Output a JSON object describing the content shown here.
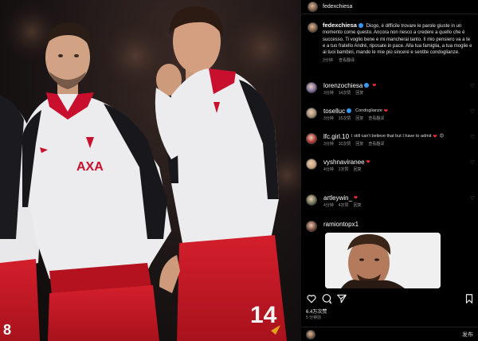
{
  "post": {
    "username": "fedexchiesa",
    "caption_user": "fedexchiesa",
    "caption_text": "Diogo, è difficile trovare le parole giuste in un momento come questo. Ancora non riesco a credere a quello che è successo. Ti voglio bene e mi mancherai tanto. Il mio pensiero va a te e a tuo fratello André, riposate in pace. Alla tua famiglia, a tua moglie e ai tuoi bambini, mando le mie più sincere e sentite condoglianze.",
    "caption_time": "3分钟",
    "caption_translate": "查看翻译",
    "likes": "6.4万次赞",
    "time": "5 分钟前",
    "compose_placeholder": "",
    "post_label": "发布"
  },
  "photo": {
    "jersey_left_text": "AXA",
    "jersey_right_number": "14",
    "left_number": "8"
  },
  "comments": [
    {
      "user": "lorenzochiesa",
      "text": "",
      "verified": true,
      "heart": true,
      "emoji": "",
      "time": "3分钟",
      "likes": "14次赞",
      "reply": "回复",
      "translate": "",
      "avatar_color": "#7a6a9a"
    },
    {
      "user": "toselluc",
      "text": "Condoglianze",
      "verified": true,
      "heart": true,
      "emoji": "",
      "time": "3分钟",
      "likes": "15次赞",
      "reply": "回复",
      "translate": "查看翻译",
      "avatar_color": "#a08a70"
    },
    {
      "user": "lfc.girl.10",
      "text": "I still can't believe that but I have to admit",
      "verified": false,
      "heart": true,
      "emoji": "😊",
      "time": "3分钟",
      "likes": "10次赞",
      "reply": "回复",
      "translate": "查看翻译",
      "avatar_color": "#b03030"
    },
    {
      "user": "vyshnaviranee",
      "text": "",
      "verified": false,
      "heart": true,
      "emoji": "",
      "time": "4分钟",
      "likes": "2次赞",
      "reply": "回复",
      "translate": "",
      "avatar_color": "#c9a07a"
    },
    {
      "user": "artleywin_",
      "text": "",
      "verified": false,
      "heart": true,
      "emoji": "",
      "time": "4分钟",
      "likes": "4次赞",
      "reply": "回复",
      "translate": "",
      "avatar_color": "#6a7050"
    },
    {
      "user": "ramiontopx1",
      "text": "",
      "verified": false,
      "heart": false,
      "emoji": "",
      "time": "",
      "likes": "",
      "reply": "",
      "translate": "",
      "avatar_color": "#7a4a3a"
    }
  ],
  "icons": {
    "like": "heart-outline-icon",
    "comment": "comment-icon",
    "share": "send-icon",
    "save": "bookmark-icon",
    "comment_like": "heart-small-icon"
  },
  "colors": {
    "accent_blue": "#3897f0",
    "heart_red": "#ff3040",
    "liverpool_red": "#c8102e"
  }
}
